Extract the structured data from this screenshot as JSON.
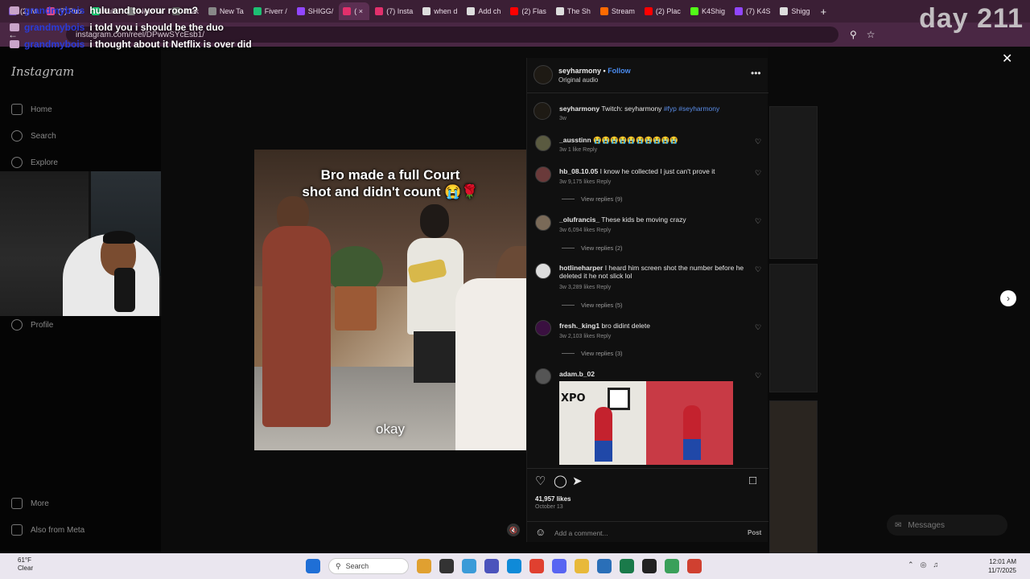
{
  "browser": {
    "tabs": [
      {
        "label": "(2) M",
        "color": "#7b52c9"
      },
      {
        "label": "(7) Pub",
        "color": "#e04a8a"
      },
      {
        "label": "Hulu",
        "color": "#1ce783"
      },
      {
        "label": "New Ta",
        "color": "#888888"
      },
      {
        "label": "Jo2k",
        "color": "#666666"
      },
      {
        "label": "New Ta",
        "color": "#888888"
      },
      {
        "label": "Fiverr /",
        "color": "#1dbf73"
      },
      {
        "label": "SHIGG/",
        "color": "#9146ff"
      },
      {
        "label": "( ×",
        "color": "#e1306c",
        "active": true
      },
      {
        "label": "(7) Insta",
        "color": "#e1306c"
      },
      {
        "label": "when d",
        "color": "#dddddd"
      },
      {
        "label": "Add ch",
        "color": "#dddddd"
      },
      {
        "label": "(2) Flas",
        "color": "#ff0000"
      },
      {
        "label": "The Sh",
        "color": "#dddddd"
      },
      {
        "label": "Stream",
        "color": "#ff6a00"
      },
      {
        "label": "(2) Plac",
        "color": "#ff0000"
      },
      {
        "label": "K4Shig",
        "color": "#53fc18"
      },
      {
        "label": "(7) K4S",
        "color": "#9146ff"
      },
      {
        "label": "Shigg",
        "color": "#dddddd"
      }
    ],
    "url": "instagram.com/reel/DPwwSYcEsb1/",
    "new_tab_label": "+"
  },
  "overlay": {
    "day_tag": "day 211",
    "chat": [
      {
        "user": "grandmybois",
        "message": "hulu and to your room?"
      },
      {
        "user": "grandmybois",
        "message": "i told you i should be the duo"
      },
      {
        "user": "grandmybois",
        "message": "i thought about it Netflix is over did"
      }
    ]
  },
  "sidebar": {
    "logo": "Instagram",
    "items": [
      {
        "label": "Home",
        "icon": "home-icon"
      },
      {
        "label": "Search",
        "icon": "search-icon"
      },
      {
        "label": "Explore",
        "icon": "compass-icon"
      },
      {
        "label": "Profile",
        "icon": "profile-icon"
      },
      {
        "label": "More",
        "icon": "menu-icon"
      },
      {
        "label": "Also from Meta",
        "icon": "meta-icon"
      }
    ]
  },
  "video": {
    "caption_line1": "Bro made a full Court",
    "caption_line2": "shot and didn't count 😭🌹",
    "subtitle": "okay",
    "mute_icon": "🔇"
  },
  "post": {
    "username": "seyharmony",
    "follow": "Follow",
    "audio": "Original audio",
    "caption_user": "seyharmony",
    "caption_text": "Twitch: seyharmony",
    "caption_tags": "#fyp #seyharmony",
    "caption_time": "3w",
    "comments": [
      {
        "user": "_ausstinn",
        "text": "😭😭😭😭😭😭😭😭😭😭",
        "meta": "3w   1 like   Reply",
        "replies": ""
      },
      {
        "user": "hb_08.10.05",
        "text": "I know he collected I just can't prove it",
        "meta": "3w   9,175 likes   Reply",
        "replies": "View replies (9)"
      },
      {
        "user": "_olufrancis_",
        "text": "These kids be moving crazy",
        "meta": "3w   6,094 likes   Reply",
        "replies": "View replies (2)"
      },
      {
        "user": "hotlineharper",
        "text": "I heard him screen shot the number before he deleted it he not slick lol",
        "meta": "3w   3,289 likes   Reply",
        "replies": "View replies (5)"
      },
      {
        "user": "fresh._king1",
        "text": "bro didint delete",
        "meta": "3w   2,103 likes   Reply",
        "replies": "View replies (3)"
      },
      {
        "user": "adam.b_02",
        "text": "",
        "meta": "",
        "replies": ""
      }
    ],
    "likes": "41,957 likes",
    "date": "October 13",
    "add_comment_placeholder": "Add a comment...",
    "post_label": "Post",
    "gif_text": "XPO"
  },
  "page": {
    "close": "✕",
    "next": "›",
    "messages": "Messages"
  },
  "taskbar": {
    "weather_temp": "61°F",
    "weather_desc": "Clear",
    "search_placeholder": "Search",
    "time": "12:01 AM",
    "date": "11/7/2025"
  }
}
